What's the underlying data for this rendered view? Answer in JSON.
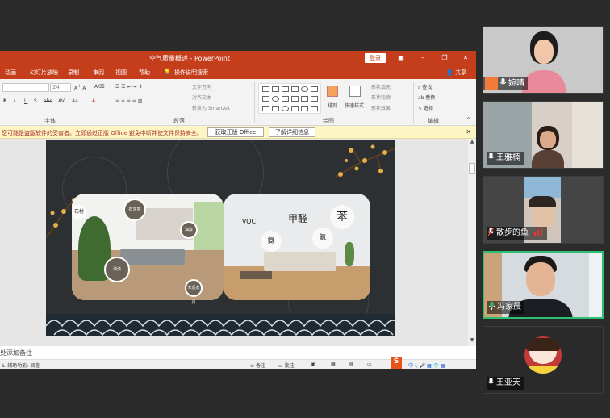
{
  "ppt": {
    "window_title": "空气质量概述 - PowerPoint",
    "login_label": "登录",
    "tabs": [
      "动画",
      "幻灯片放映",
      "录制",
      "审阅",
      "视图",
      "帮助",
      "操作说明搜索"
    ],
    "share_label": "共享",
    "ribbon": {
      "font_size": "24",
      "text_direction": "文字方向",
      "align_text": "对齐文本",
      "convert_smartart": "转换为 SmartArt",
      "arrange_label": "排列",
      "quick_styles_label": "快速样式",
      "shape_fill": "形状填充",
      "shape_outline": "形状轮廓",
      "shape_effects": "形状效果",
      "find_label": "查找",
      "replace_label": "替换",
      "select_label": "选择",
      "group_font": "字体",
      "group_paragraph": "段落",
      "group_drawing": "绘图",
      "group_editing": "编辑"
    },
    "warning": {
      "message": "您可能是盗版软件的受害者。立即通过正版 Office 避免中断并使文件保持安全。",
      "btn_get": "获取正版 Office",
      "btn_learn": "了解详细信息"
    },
    "slide": {
      "left_bubbles": [
        "石材",
        "石灰墙",
        "油漆",
        "油漆",
        "木质家具"
      ],
      "right_words": [
        "TVOC",
        "甲醛",
        "苯",
        "氨",
        "氡"
      ]
    },
    "notes_placeholder": "处添加备注",
    "status": {
      "accessibility": "辅助功能: 调查",
      "notes": "备注",
      "comments": "批注"
    }
  },
  "participants": [
    {
      "name": "婉晴",
      "muted": false
    },
    {
      "name": "王雅楠",
      "muted": false
    },
    {
      "name": "散步的鱼",
      "muted": true
    },
    {
      "name": "冯家晨",
      "muted": false
    },
    {
      "name": "王亚天",
      "muted": false
    }
  ],
  "colors": {
    "ppt_accent": "#c43e1c",
    "active_speaker": "#2fbf71",
    "warning_bg": "#fdf6c3"
  }
}
